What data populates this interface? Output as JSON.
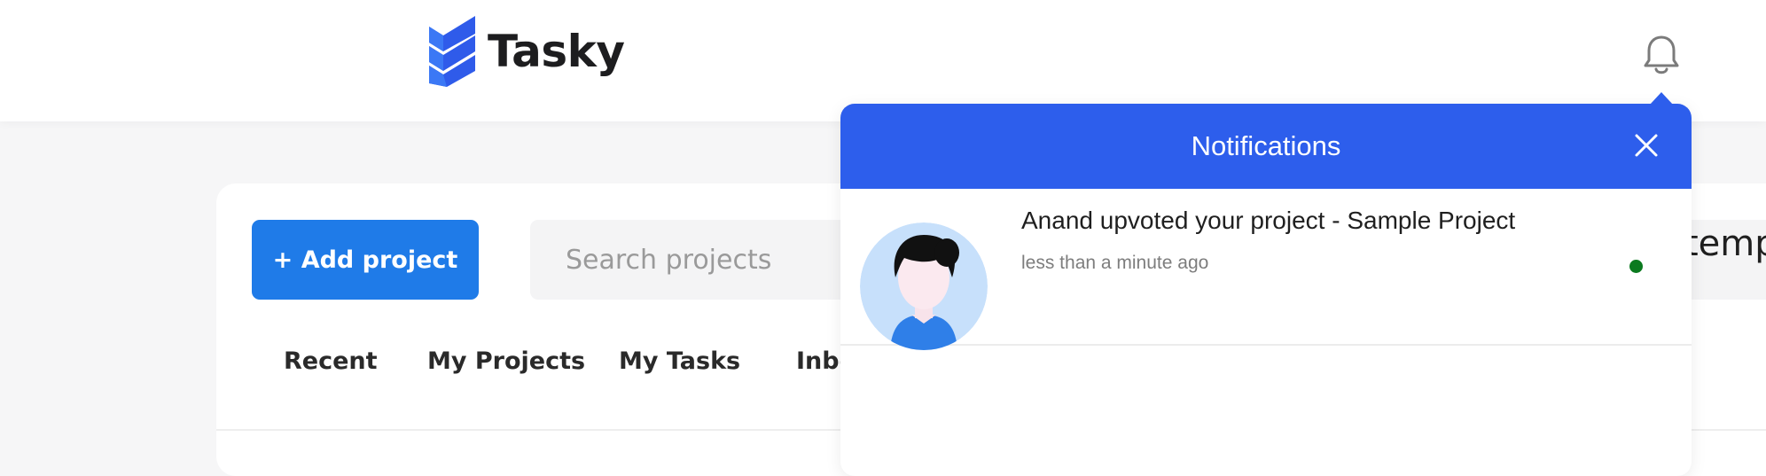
{
  "app": {
    "name": "Tasky",
    "brand_color": "#2f5bea",
    "accent_color": "#1f7be8"
  },
  "header": {
    "bell_icon": "bell-icon"
  },
  "toolbar": {
    "add_project_label": "+ Add project",
    "search_placeholder": "Search projects",
    "search_partial_value": "temp"
  },
  "tabs": [
    {
      "label": "Recent"
    },
    {
      "label": "My Projects"
    },
    {
      "label": "My Tasks"
    },
    {
      "label": "Inbo"
    }
  ],
  "notifications": {
    "title": "Notifications",
    "header_color": "#2d5eec",
    "close_icon": "close-icon",
    "items": [
      {
        "message": "Anand upvoted your project - Sample Project",
        "time": "less than a minute ago",
        "unread": true,
        "avatar_icon": "user-avatar-icon"
      }
    ]
  }
}
